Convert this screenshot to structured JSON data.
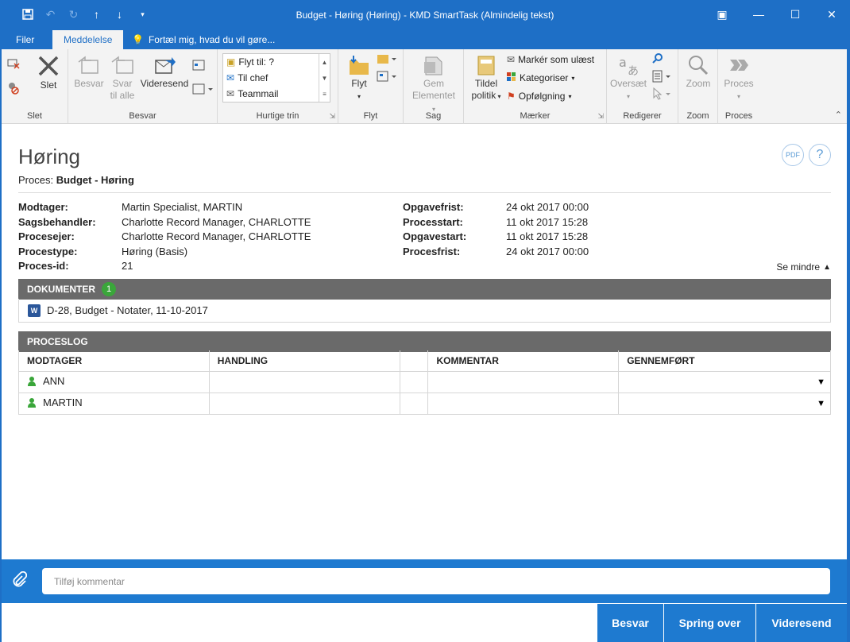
{
  "window": {
    "title": "Budget - Høring (Høring) - KMD SmartTask (Almindelig tekst)",
    "controls": [
      "▣",
      "—",
      "☐",
      "✕"
    ]
  },
  "tabs": {
    "file": "Filer",
    "message": "Meddelelse",
    "tellme": "Fortæl mig, hvad du vil gøre..."
  },
  "ribbon": {
    "slet": {
      "delete": "Slet",
      "label": "Slet"
    },
    "besvar": {
      "reply": "Besvar",
      "reply_all_1": "Svar",
      "reply_all_2": "til alle",
      "forward": "Videresend",
      "label": "Besvar"
    },
    "quick": {
      "items": [
        "Flyt til: ?",
        "Til chef",
        "Teammail"
      ],
      "label": "Hurtige trin"
    },
    "flyt": {
      "move": "Flyt",
      "label": "Flyt"
    },
    "sag": {
      "save_1": "Gem",
      "save_2": "Elementet",
      "label": "Sag"
    },
    "maerker": {
      "assign_1": "Tildel",
      "assign_2": "politik",
      "mark_unread": "Markér som ulæst",
      "categorize": "Kategoriser",
      "followup": "Opfølgning",
      "label": "Mærker"
    },
    "redigerer": {
      "translate_1": "Oversæt",
      "label": "Redigerer"
    },
    "zoom": {
      "zoom": "Zoom",
      "label": "Zoom"
    },
    "proces": {
      "proces": "Proces",
      "label": "Proces"
    }
  },
  "page": {
    "title": "Høring",
    "process_label": "Proces:",
    "process_value": "Budget - Høring",
    "pdf": "PDF",
    "help": "?"
  },
  "fields_left": [
    {
      "k": "Modtager:",
      "v": "Martin Specialist, MARTIN"
    },
    {
      "k": "Sagsbehandler:",
      "v": "Charlotte Record Manager, CHARLOTTE"
    },
    {
      "k": "Procesejer:",
      "v": "Charlotte Record Manager, CHARLOTTE"
    },
    {
      "k": "Procestype:",
      "v": "Høring (Basis)"
    },
    {
      "k": "Proces-id:",
      "v": "21"
    }
  ],
  "fields_right": [
    {
      "k": "Opgavefrist:",
      "v": "24 okt 2017 00:00"
    },
    {
      "k": "Processtart:",
      "v": "11 okt 2017 15:28"
    },
    {
      "k": "Opgavestart:",
      "v": "11 okt 2017 15:28"
    },
    {
      "k": "Procesfrist:",
      "v": "24 okt 2017 00:00"
    }
  ],
  "see_less": "Se mindre",
  "documents": {
    "header": "DOKUMENTER",
    "count": "1",
    "items": [
      {
        "name": "D-28, Budget - Notater, 11-10-2017"
      }
    ]
  },
  "proceslog": {
    "header": "PROCESLOG",
    "columns": [
      "MODTAGER",
      "HANDLING",
      "",
      "KOMMENTAR",
      "GENNEMFØRT"
    ],
    "rows": [
      {
        "modtager": "ANN"
      },
      {
        "modtager": "MARTIN"
      }
    ]
  },
  "comment": {
    "placeholder": "Tilføj kommentar"
  },
  "footer": {
    "reply": "Besvar",
    "skip": "Spring over",
    "forward": "Videresend"
  },
  "colors": {
    "brand_blue": "#1e6fc6",
    "action_blue": "#1e7ad0",
    "section_gray": "#6a6a6a",
    "badge_green": "#3aa63a"
  }
}
